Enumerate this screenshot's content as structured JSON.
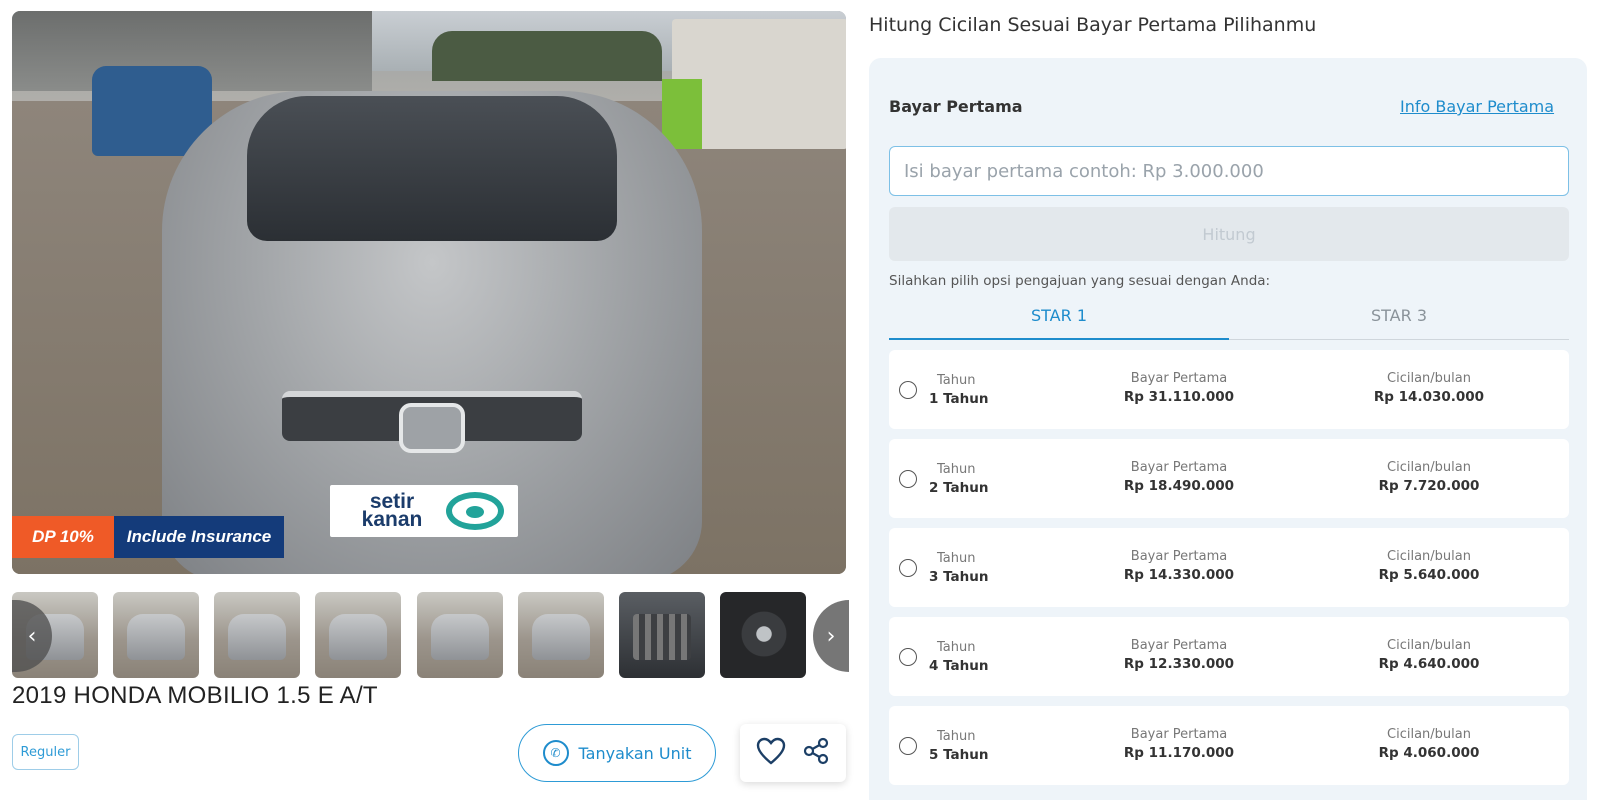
{
  "gallery": {
    "badges": {
      "dp": "DP 10%",
      "insurance": "Include Insurance"
    },
    "plate_brand": "setir kanan",
    "thumbnail_count": 8
  },
  "listing": {
    "title": "2019 HONDA MOBILIO 1.5 E A/T",
    "tag": "Reguler",
    "ask_button": "Tanyakan Unit"
  },
  "calculator": {
    "heading": "Hitung Cicilan Sesuai Bayar Pertama Pilihanmu",
    "dp_label": "Bayar Pertama",
    "dp_info_link": "Info Bayar Pertama",
    "dp_placeholder": "Isi bayar pertama contoh: Rp 3.000.000",
    "calc_button": "Hitung",
    "option_hint": "Silahkan pilih opsi pengajuan yang sesuai dengan Anda:",
    "tabs": [
      {
        "label": "STAR 1",
        "active": true
      },
      {
        "label": "STAR 3",
        "active": false
      }
    ],
    "col_labels": {
      "tenor": "Tahun",
      "dp": "Bayar Pertama",
      "monthly": "Cicilan/bulan"
    },
    "plans": [
      {
        "tenor": "1 Tahun",
        "dp": "Rp 31.110.000",
        "monthly": "Rp 14.030.000"
      },
      {
        "tenor": "2 Tahun",
        "dp": "Rp 18.490.000",
        "monthly": "Rp 7.720.000"
      },
      {
        "tenor": "3 Tahun",
        "dp": "Rp 14.330.000",
        "monthly": "Rp 5.640.000"
      },
      {
        "tenor": "4 Tahun",
        "dp": "Rp 12.330.000",
        "monthly": "Rp 4.640.000"
      },
      {
        "tenor": "5 Tahun",
        "dp": "Rp 11.170.000",
        "monthly": "Rp 4.060.000"
      }
    ]
  },
  "colors": {
    "accent": "#1e8ccc",
    "dp_badge": "#ef5a27",
    "insurance_badge": "#143b7a",
    "panel_bg": "#eef4f9"
  }
}
